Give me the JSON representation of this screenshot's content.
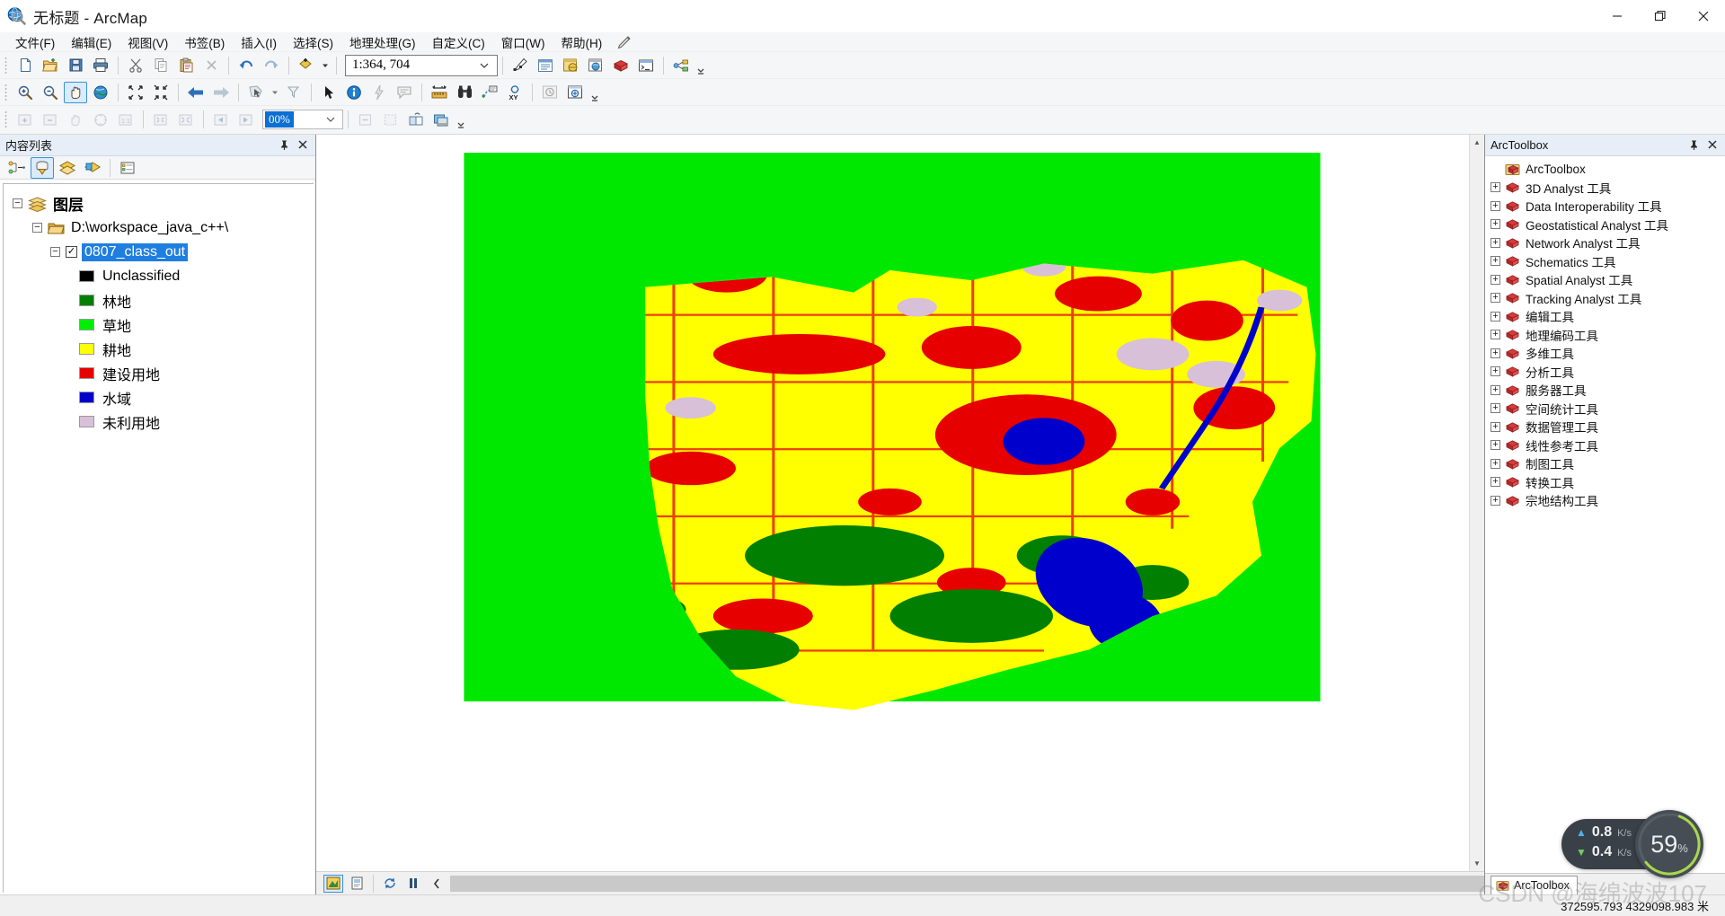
{
  "window": {
    "title": "无标题 - ArcMap",
    "app_icon": "arcmap-globe-magnifier-icon",
    "minimize_label": "—",
    "restore_label": "❐",
    "close_label": "✕"
  },
  "menubar": {
    "items": [
      {
        "label": "文件(F)",
        "name": "menu-file"
      },
      {
        "label": "编辑(E)",
        "name": "menu-edit"
      },
      {
        "label": "视图(V)",
        "name": "menu-view"
      },
      {
        "label": "书签(B)",
        "name": "menu-bookmarks"
      },
      {
        "label": "插入(I)",
        "name": "menu-insert"
      },
      {
        "label": "选择(S)",
        "name": "menu-selection"
      },
      {
        "label": "地理处理(G)",
        "name": "menu-geoprocessing"
      },
      {
        "label": "自定义(C)",
        "name": "menu-customize"
      },
      {
        "label": "窗口(W)",
        "name": "menu-window"
      },
      {
        "label": "帮助(H)",
        "name": "menu-help"
      }
    ]
  },
  "toolbar_standard": {
    "scale_value": "1:364, 704",
    "scale_placeholder": "1:364, 704",
    "buttons": [
      "new-document-icon",
      "open-folder-icon",
      "save-icon",
      "print-icon",
      "cut-scissors-icon",
      "copy-icon",
      "paste-icon",
      "delete-x-icon",
      "undo-arrow-icon",
      "redo-arrow-icon",
      "add-data-icon"
    ],
    "right_buttons": [
      "editor-toolbar-icon",
      "table-of-contents-icon",
      "catalog-window-icon",
      "search-window-icon",
      "arctoolbox-icon",
      "python-window-icon",
      "modelbuilder-icon"
    ]
  },
  "toolbar_tools": {
    "buttons": [
      "zoom-in-icon",
      "zoom-out-icon",
      "pan-hand-icon",
      "full-extent-globe-icon",
      "fixed-zoom-in-icon",
      "fixed-zoom-out-icon",
      "go-back-extent-icon",
      "go-next-extent-icon",
      "select-features-icon",
      "clear-selection-icon",
      "select-elements-arrow-icon",
      "identify-info-icon",
      "hyperlink-icon",
      "html-popup-icon",
      "measure-ruler-icon",
      "find-binoculars-icon",
      "find-route-icon",
      "go-to-xy-icon",
      "time-slider-icon",
      "create-viewer-icon"
    ],
    "active": "pan-hand-icon"
  },
  "toolbar_effects": {
    "zoom_value": "00%",
    "buttons": [
      "image-zoom-in-icon",
      "image-zoom-out-icon",
      "image-pan-icon",
      "image-fit-icon",
      "image-actual-size-icon",
      "image-collapse-icon",
      "image-expand-icon",
      "image-prev-icon",
      "image-next-icon"
    ],
    "right_buttons": [
      "clear-icon",
      "select-region-icon",
      "swipe-icon",
      "flicker-icon"
    ]
  },
  "toc": {
    "title": "内容列表",
    "pin_label": "⌐",
    "close_label": "✕",
    "toolbar_buttons": [
      "list-by-drawing-order-icon",
      "list-by-source-icon",
      "list-by-visibility-icon",
      "list-by-selection-icon",
      "options-icon"
    ],
    "active_toolbar_button": "list-by-source-icon",
    "tree": {
      "root_label": "图层",
      "root_icon": "layers-stack-icon",
      "folder_label": "D:\\workspace_java_c++\\",
      "folder_icon": "folder-open-icon",
      "layer_label": "0807_class_out",
      "layer_selected": true,
      "legend": [
        {
          "label": "Unclassified",
          "color": "#000000"
        },
        {
          "label": "林地",
          "color": "#007f00"
        },
        {
          "label": "草地",
          "color": "#00ee00"
        },
        {
          "label": "耕地",
          "color": "#ffff00"
        },
        {
          "label": "建设用地",
          "color": "#e60000"
        },
        {
          "label": "水域",
          "color": "#0000cc"
        },
        {
          "label": "未利用地",
          "color": "#d8c0d8"
        }
      ]
    }
  },
  "map": {
    "background_color": "#ffffff",
    "extent_fill": "#00e800",
    "bottom_buttons": [
      "data-view-icon",
      "layout-view-icon",
      "refresh-icon",
      "pause-drawing-icon"
    ],
    "active_bottom_button": "data-view-icon",
    "collapse_label": "‹"
  },
  "arctoolbox": {
    "title": "ArcToolbox",
    "pin_label": "⌐",
    "close_label": "✕",
    "root_label": "ArcToolbox",
    "root_icon": "arctoolbox-root-icon",
    "items": [
      "3D Analyst 工具",
      "Data Interoperability 工具",
      "Geostatistical Analyst 工具",
      "Network Analyst 工具",
      "Schematics 工具",
      "Spatial Analyst 工具",
      "Tracking Analyst 工具",
      "编辑工具",
      "地理编码工具",
      "多维工具",
      "分析工具",
      "服务器工具",
      "空间统计工具",
      "数据管理工具",
      "线性参考工具",
      "制图工具",
      "转换工具",
      "宗地结构工具"
    ],
    "tab_label": "ArcToolbox",
    "tab_icon": "arctoolbox-root-icon"
  },
  "statusbar": {
    "coordinates": "372595.793  4329098.983 米"
  },
  "net_widget": {
    "upload_value": "0.8",
    "upload_unit": "K/s",
    "upload_arrow": "▲",
    "download_value": "0.4",
    "download_unit": "K/s",
    "download_arrow": "▼",
    "percent": "59",
    "percent_symbol": "%",
    "ring_color": "#a8d94a",
    "accent_up": "#4fb0e8",
    "accent_down": "#6fcf5f"
  },
  "watermark": {
    "text": "CSDN @海绵波波107"
  },
  "colors": {
    "selection_blue": "#1f7fe0",
    "panel_header": "#e7eef7",
    "chrome": "#f5f6f7"
  }
}
